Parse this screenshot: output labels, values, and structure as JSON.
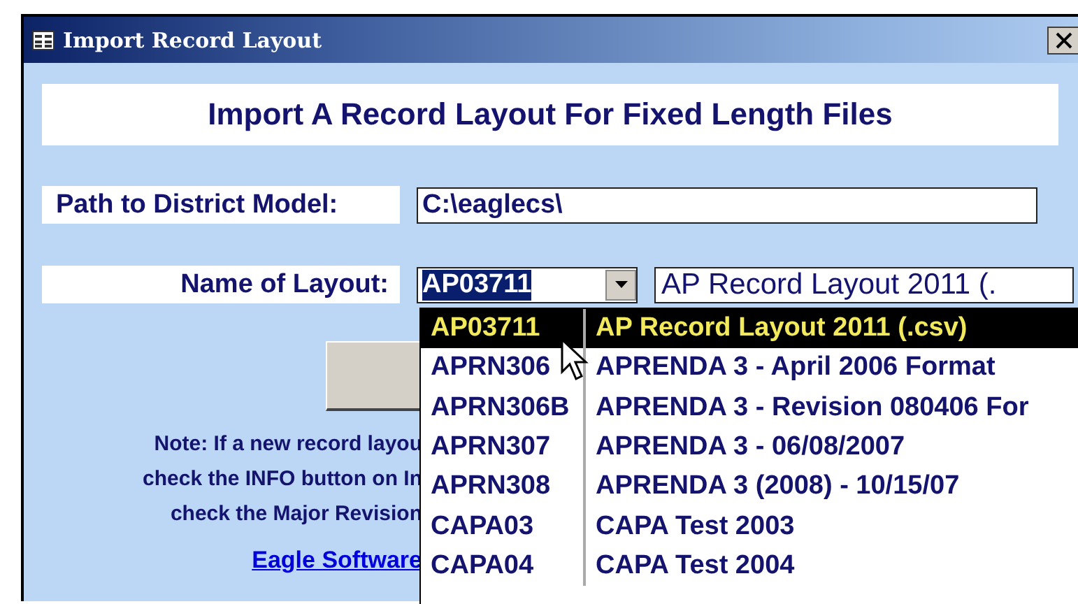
{
  "window": {
    "title": "Import Record Layout"
  },
  "heading": "Import A Record Layout For Fixed Length Files",
  "path_field": {
    "label": "Path to District Model:",
    "value": "C:\\eaglecs\\"
  },
  "layout_field": {
    "label": "Name of Layout:",
    "value": "AP03711",
    "description": "AP Record Layout 2011 (."
  },
  "note_lines": [
    "Note: If a new record layou",
    "check the INFO button on In",
    "check the Major Revision"
  ],
  "link": "Eagle Software",
  "dropdown": {
    "rows": [
      {
        "code": "AP03711",
        "description": "AP Record Layout 2011 (.csv)",
        "selected": true
      },
      {
        "code": "APRN306",
        "description": "APRENDA 3 - April 2006 Format",
        "selected": false
      },
      {
        "code": "APRN306B",
        "description": "APRENDA 3 - Revision 080406 For",
        "selected": false
      },
      {
        "code": "APRN307",
        "description": "APRENDA 3 - 06/08/2007",
        "selected": false
      },
      {
        "code": "APRN308",
        "description": "APRENDA 3 (2008) - 10/15/07",
        "selected": false
      },
      {
        "code": "CAPA03",
        "description": "CAPA Test 2003",
        "selected": false
      },
      {
        "code": "CAPA04",
        "description": "CAPA Test 2004",
        "selected": false
      }
    ]
  }
}
